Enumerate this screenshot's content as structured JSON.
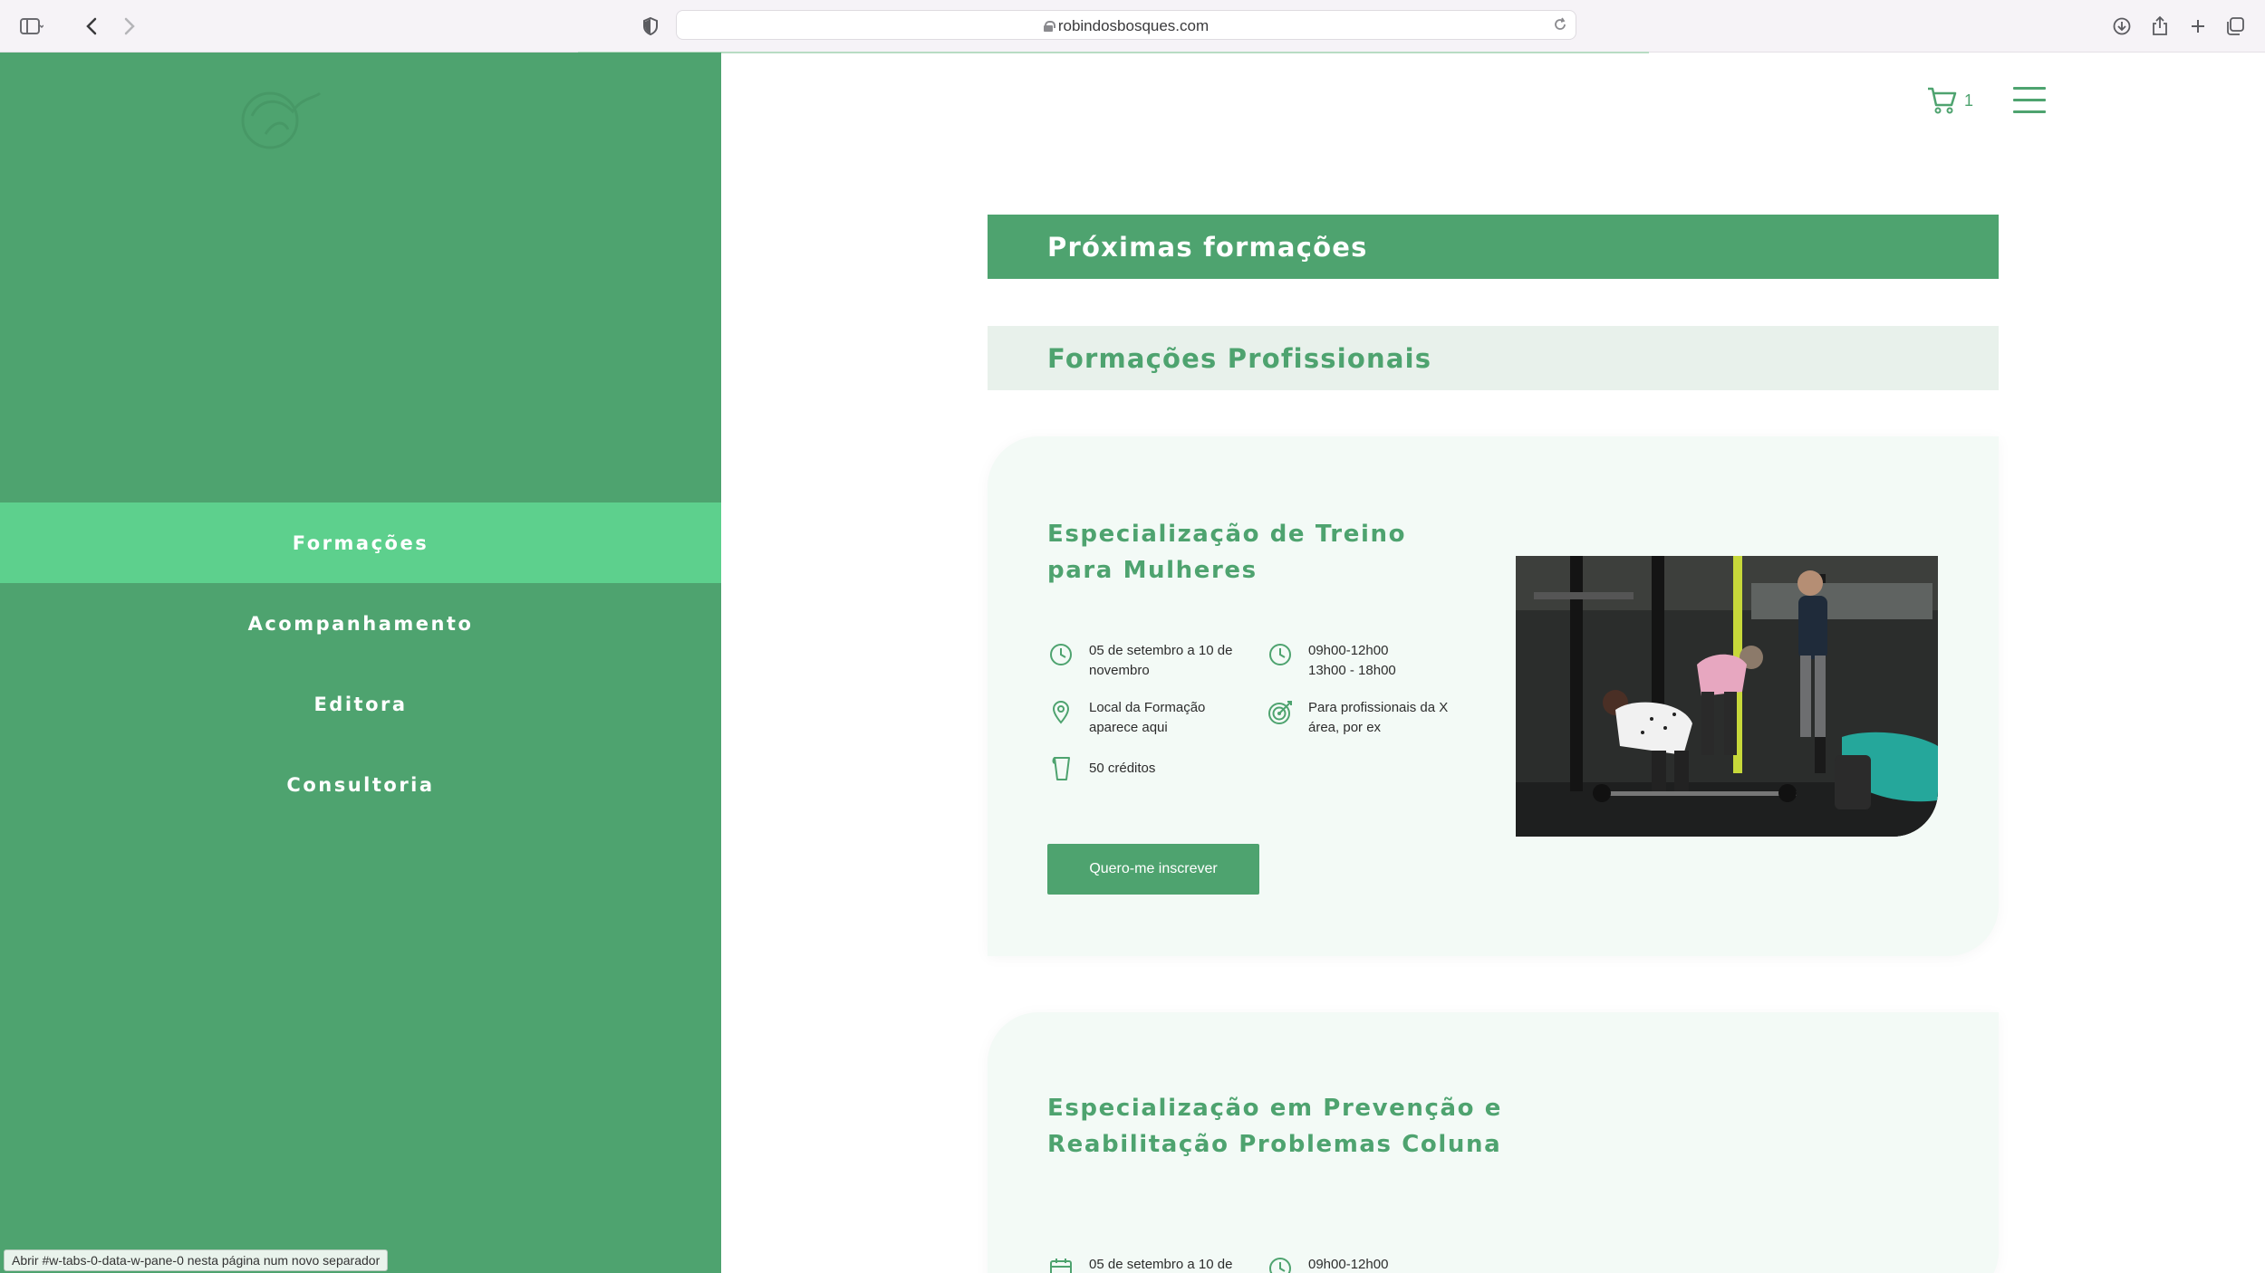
{
  "browser": {
    "url": "robindosbosques.com"
  },
  "sidebar": {
    "items": [
      {
        "label": "Formações",
        "active": true
      },
      {
        "label": "Acompanhamento",
        "active": false
      },
      {
        "label": "Editora",
        "active": false
      },
      {
        "label": "Consultoria",
        "active": false
      }
    ]
  },
  "header": {
    "cart_count": "1"
  },
  "main": {
    "title": "Próximas formações",
    "subtitle": "Formações Profissionais",
    "courses": [
      {
        "title": "Especialização de Treino para Mulheres",
        "dates": "05 de setembro a 10 de novembro",
        "schedule_line1": "09h00-12h00",
        "schedule_line2": "13h00 - 18h00",
        "location": "Local da Formação aparece aqui",
        "audience": "Para profissionais da X área, por ex",
        "credits": "50 créditos",
        "cta": "Quero-me inscrever"
      },
      {
        "title": "Especialização em Prevenção e Reabilitação Problemas Coluna",
        "dates": "05 de setembro a 10 de",
        "schedule_line1": "09h00-12h00"
      }
    ]
  },
  "status_bar": {
    "link_hint": "Abrir #w-tabs-0-data-w-pane-0 nesta página num novo separador"
  },
  "colors": {
    "brand_green": "#4ea36f",
    "active_green": "#5dd08d",
    "card_bg": "#f3faf6",
    "subbanner_bg": "#e8f1eb"
  }
}
